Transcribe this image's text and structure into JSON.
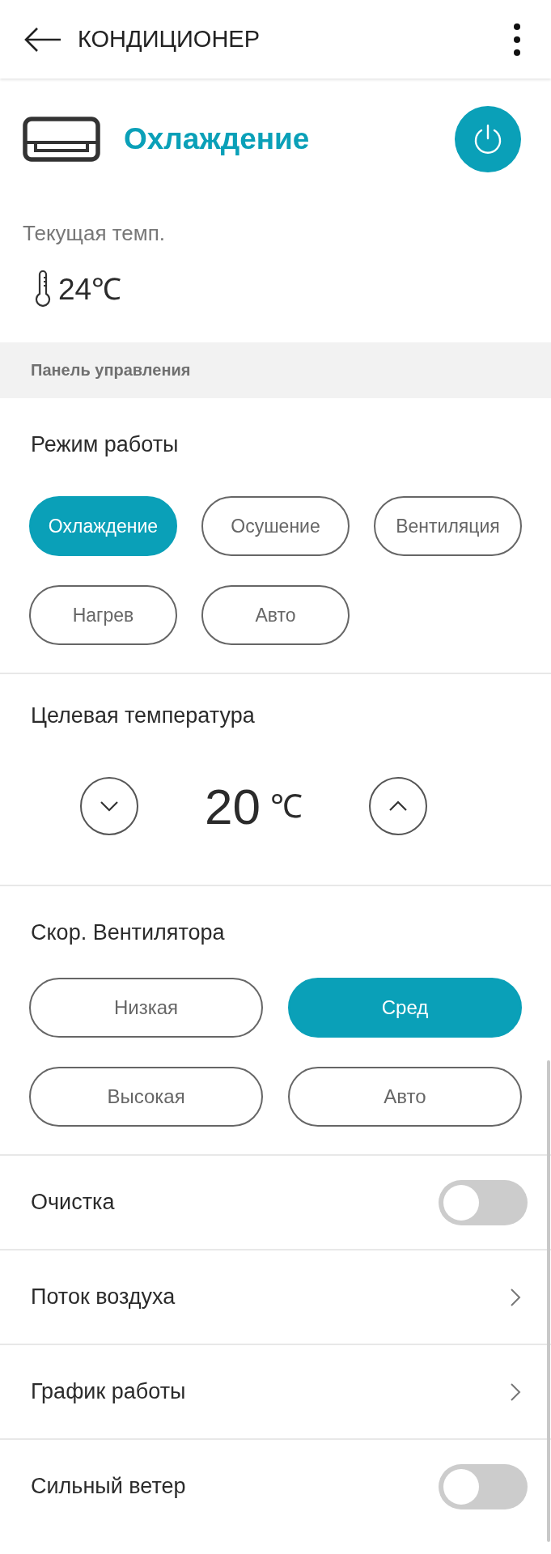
{
  "header": {
    "title": "КОНДИЦИОНЕР"
  },
  "status": {
    "mode": "Охлаждение",
    "power_on": true,
    "current_label": "Текущая темп.",
    "current_temp": "24℃"
  },
  "section": {
    "title": "Панель управления"
  },
  "mode_group": {
    "title": "Режим работы",
    "options": [
      {
        "label": "Охлаждение",
        "selected": true
      },
      {
        "label": "Осушение",
        "selected": false
      },
      {
        "label": "Вентиляция",
        "selected": false
      },
      {
        "label": "Нагрев",
        "selected": false
      },
      {
        "label": "Авто",
        "selected": false
      }
    ]
  },
  "target": {
    "title": "Целевая температура",
    "value": "20",
    "unit": "℃"
  },
  "fan_group": {
    "title": "Скор. Вентилятора",
    "options": [
      {
        "label": "Низкая",
        "selected": false
      },
      {
        "label": "Сред",
        "selected": true
      },
      {
        "label": "Высокая",
        "selected": false
      },
      {
        "label": "Авто",
        "selected": false
      }
    ]
  },
  "settings": [
    {
      "kind": "toggle",
      "label": "Очистка",
      "on": false
    },
    {
      "kind": "link",
      "label": "Поток воздуха"
    },
    {
      "kind": "link",
      "label": "График работы"
    },
    {
      "kind": "toggle",
      "label": "Сильный ветер",
      "on": false
    }
  ]
}
